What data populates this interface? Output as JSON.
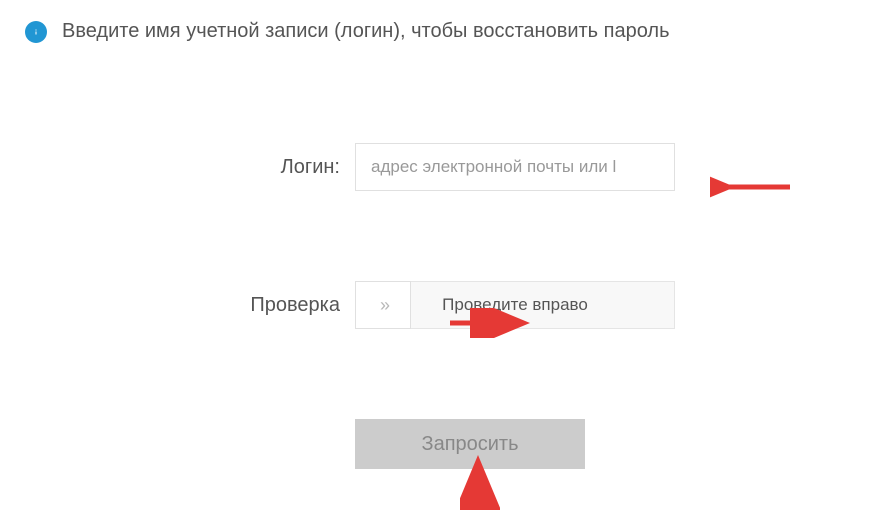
{
  "info": {
    "text": "Введите имя учетной записи (логин), чтобы восстановить пароль"
  },
  "form": {
    "login": {
      "label": "Логин:",
      "placeholder": "адрес электронной почты или l",
      "value": ""
    },
    "verification": {
      "label": "Проверка",
      "slider_text": "Проведите вправо",
      "handle_glyph": "»"
    },
    "submit": {
      "label": "Запросить"
    }
  },
  "annotations": {
    "arrow_color": "#e53935"
  }
}
